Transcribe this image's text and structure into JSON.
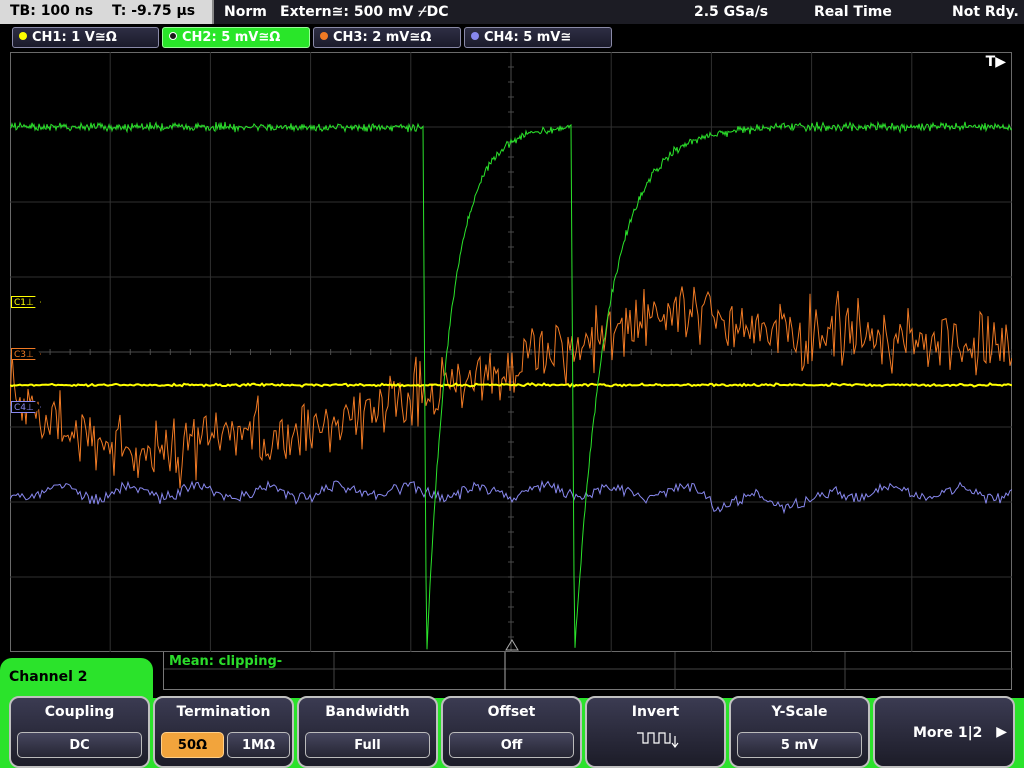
{
  "status_bar": {
    "timebase": "TB: 100 ns",
    "trigger_time": "T: -9.75 µs",
    "trigger_mode": "Norm",
    "trigger_source": "Extern≅: 500 mV ⌿DC",
    "sample_rate": "2.5 GSa/s",
    "acq_mode": "Real Time",
    "run_state": "Not Rdy."
  },
  "channels": [
    {
      "label": "CH1: 1 V≅Ω",
      "color": "#ffff00"
    },
    {
      "label": "CH2: 5 mV≅Ω",
      "color": "#2be32b",
      "active": true
    },
    {
      "label": "CH3: 2 mV≅Ω",
      "color": "#f07a24"
    },
    {
      "label": "CH4: 5 mV≅",
      "color": "#8888ee"
    }
  ],
  "markers": {
    "c1": "C1⊥",
    "c3": "C3⊥",
    "c4": "C4⊥",
    "trigger": "T▶"
  },
  "measurement": {
    "text": "Mean: clipping-"
  },
  "menu": {
    "title": "Channel 2",
    "coupling": {
      "label": "Coupling",
      "value": "DC"
    },
    "termination": {
      "label": "Termination",
      "opt1": "50Ω",
      "opt2": "1MΩ",
      "selected": "50Ω"
    },
    "bandwidth": {
      "label": "Bandwidth",
      "value": "Full"
    },
    "offset": {
      "label": "Offset",
      "value": "Off"
    },
    "invert": {
      "label": "Invert",
      "icon": "square-wave-invert-icon"
    },
    "yscale": {
      "label": "Y-Scale",
      "value": "5 mV"
    },
    "more": {
      "label": "More 1|2",
      "icon": "arrow-right-icon"
    }
  },
  "colors": {
    "ch1": "#ffff00",
    "ch2": "#2be32b",
    "ch3": "#f07a24",
    "ch4": "#8888ee",
    "grid": "#3a3a3a",
    "accent": "#f2a43c"
  }
}
